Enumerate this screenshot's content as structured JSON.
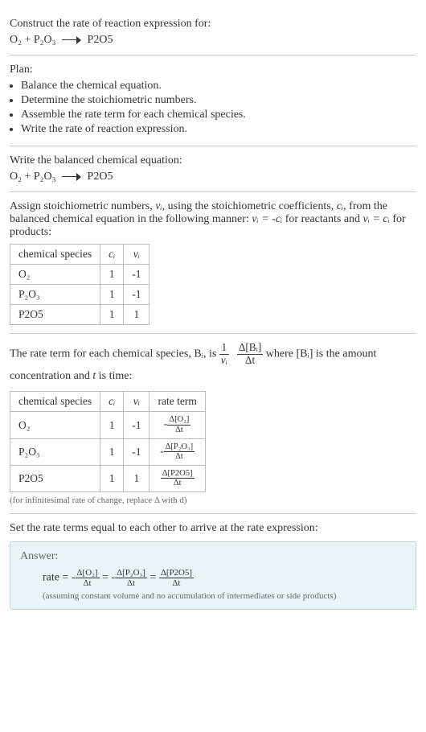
{
  "intro": {
    "prompt": "Construct the rate of reaction expression for:",
    "reactants": "O₂ + P₂O₃",
    "product": "P2O5"
  },
  "plan": {
    "label": "Plan:",
    "items": [
      "Balance the chemical equation.",
      "Determine the stoichiometric numbers.",
      "Assemble the rate term for each chemical species.",
      "Write the rate of reaction expression."
    ]
  },
  "balanced": {
    "label": "Write the balanced chemical equation:",
    "reactants": "O₂ + P₂O₃",
    "product": "P2O5"
  },
  "stoich": {
    "intro_p1": "Assign stoichiometric numbers, ",
    "nu_i": "νᵢ",
    "intro_p2": ", using the stoichiometric coefficients, ",
    "c_i": "cᵢ",
    "intro_p3": ", from the balanced chemical equation in the following manner: ",
    "rule1": "νᵢ = -cᵢ",
    "intro_p4": " for reactants and ",
    "rule2": "νᵢ = cᵢ",
    "intro_p5": " for products:",
    "headers": {
      "species": "chemical species",
      "ci": "cᵢ",
      "nui": "νᵢ"
    },
    "rows": [
      {
        "species": "O₂",
        "ci": "1",
        "nui": "-1"
      },
      {
        "species": "P₂O₃",
        "ci": "1",
        "nui": "-1"
      },
      {
        "species": "P2O5",
        "ci": "1",
        "nui": "1"
      }
    ]
  },
  "rateterm": {
    "intro_p1": "The rate term for each chemical species, Bᵢ, is ",
    "frac1_num": "1",
    "frac1_den": "νᵢ",
    "frac2_num": "Δ[Bᵢ]",
    "frac2_den": "Δt",
    "intro_p2": " where [Bᵢ] is the amount concentration and ",
    "t": "t",
    "intro_p3": " is time:",
    "headers": {
      "species": "chemical species",
      "ci": "cᵢ",
      "nui": "νᵢ",
      "rate": "rate term"
    },
    "rows": [
      {
        "species": "O₂",
        "ci": "1",
        "nui": "-1",
        "neg": "-",
        "num": "Δ[O₂]",
        "den": "Δt"
      },
      {
        "species": "P₂O₃",
        "ci": "1",
        "nui": "-1",
        "neg": "-",
        "num": "Δ[P₂O₃]",
        "den": "Δt"
      },
      {
        "species": "P2O5",
        "ci": "1",
        "nui": "1",
        "neg": "",
        "num": "Δ[P2O5]",
        "den": "Δt"
      }
    ],
    "note": "(for infinitesimal rate of change, replace Δ with d)"
  },
  "final": {
    "label": "Set the rate terms equal to each other to arrive at the rate expression:",
    "answer_label": "Answer:",
    "rate_eq_prefix": "rate = ",
    "t1_neg": "-",
    "t1_num": "Δ[O₂]",
    "t1_den": "Δt",
    "eq1": " = ",
    "t2_neg": "-",
    "t2_num": "Δ[P₂O₃]",
    "t2_den": "Δt",
    "eq2": " = ",
    "t3_num": "Δ[P2O5]",
    "t3_den": "Δt",
    "assumption": "(assuming constant volume and no accumulation of intermediates or side products)"
  }
}
